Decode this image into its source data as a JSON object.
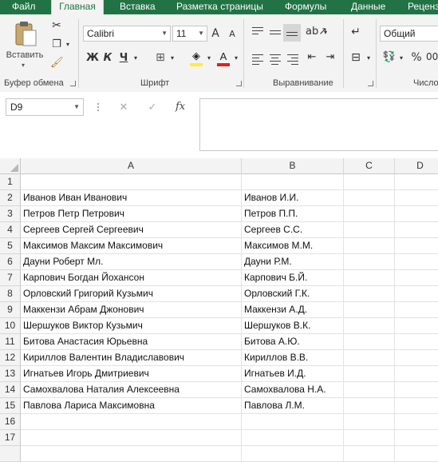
{
  "ribbon_tabs": [
    "Файл",
    "Главная",
    "Вставка",
    "Разметка страницы",
    "Формулы",
    "Данные",
    "Реценз"
  ],
  "active_tab": "Главная",
  "clipboard": {
    "paste_label": "Вставить",
    "group_label": "Буфер обмена"
  },
  "font": {
    "name": "Calibri",
    "size": "11",
    "group_label": "Шрифт",
    "bold": "Ж",
    "italic": "К",
    "underline": "Ч",
    "grow": "A",
    "shrink": "A",
    "font_color": "A"
  },
  "alignment": {
    "group_label": "Выравнивание"
  },
  "number": {
    "format": "Общий",
    "group_label": "Число",
    "percent": "%"
  },
  "formula_bar": {
    "name_box": "D9",
    "fx": "fx",
    "value": ""
  },
  "columns": [
    "A",
    "B",
    "C",
    "D"
  ],
  "rows": [
    {
      "n": "1",
      "a": "",
      "b": ""
    },
    {
      "n": "2",
      "a": "Иванов Иван Иванович",
      "b": "Иванов И.И."
    },
    {
      "n": "3",
      "a": "Петров Петр Петрович",
      "b": "Петров П.П."
    },
    {
      "n": "4",
      "a": "Сергеев Сергей Сергеевич",
      "b": "Сергеев С.С."
    },
    {
      "n": "5",
      "a": "Максимов Максим Максимович",
      "b": "Максимов М.М."
    },
    {
      "n": "6",
      "a": "Дауни Роберт Мл.",
      "b": "Дауни Р.М."
    },
    {
      "n": "7",
      "a": "Карпович Богдан Йохансон",
      "b": "Карпович Б.Й."
    },
    {
      "n": "8",
      "a": "Орловский Григорий Кузьмич",
      "b": "Орловский Г.К."
    },
    {
      "n": "9",
      "a": "Маккензи Абрам Джонович",
      "b": "Маккензи А.Д."
    },
    {
      "n": "10",
      "a": "Шершуков Виктор Кузьмич",
      "b": "Шершуков В.К."
    },
    {
      "n": "11",
      "a": "Битова Анастасия Юрьевна",
      "b": "Битова А.Ю."
    },
    {
      "n": "12",
      "a": "Кириллов Валентин Владиславович",
      "b": "Кириллов В.В."
    },
    {
      "n": "13",
      "a": "Игнатьев Игорь Дмитриевич",
      "b": "Игнатьев И.Д."
    },
    {
      "n": "14",
      "a": "Самохвалова Наталия Алексеевна",
      "b": "Самохвалова Н.А."
    },
    {
      "n": "15",
      "a": "Павлова Лариса Максимовна",
      "b": "Павлова Л.М."
    },
    {
      "n": "16",
      "a": "",
      "b": ""
    },
    {
      "n": "17",
      "a": "",
      "b": ""
    },
    {
      "n": "",
      "a": "",
      "b": ""
    }
  ],
  "colors": {
    "brand": "#217346",
    "ribbon_bg": "#f3f3f3",
    "highlight": "#ffeb3b",
    "font_red": "#e02020"
  }
}
